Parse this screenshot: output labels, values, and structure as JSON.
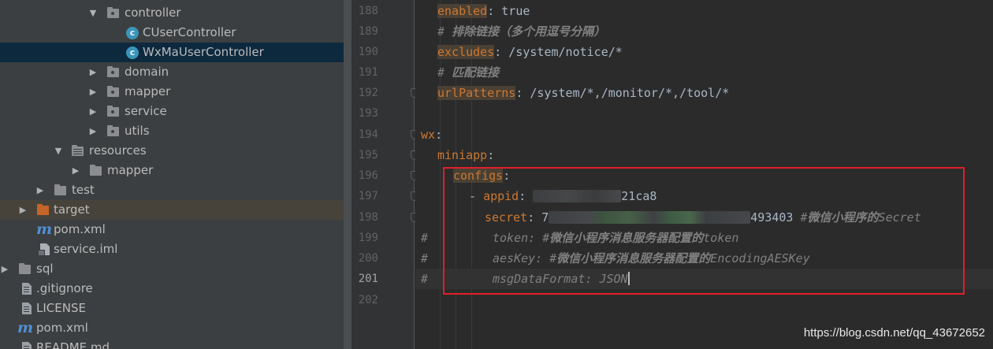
{
  "tree": {
    "items": [
      {
        "label": "controller",
        "arrow": "▼",
        "icon": "package-folder-icon",
        "level": "pkg"
      },
      {
        "label": "CUserController",
        "arrow": "",
        "icon": "java-class-icon"
      },
      {
        "label": "WxMaUserController",
        "arrow": "",
        "icon": "java-class-icon",
        "selected": true
      },
      {
        "label": "domain",
        "arrow": "▶",
        "icon": "package-folder-icon"
      },
      {
        "label": "mapper",
        "arrow": "▶",
        "icon": "package-folder-icon"
      },
      {
        "label": "service",
        "arrow": "▶",
        "icon": "package-folder-icon"
      },
      {
        "label": "utils",
        "arrow": "▶",
        "icon": "package-folder-icon"
      },
      {
        "label": "resources",
        "arrow": "▼",
        "icon": "resources-folder-icon"
      },
      {
        "label": "mapper",
        "arrow": "▶",
        "icon": "folder-icon"
      },
      {
        "label": "test",
        "arrow": "▶",
        "icon": "folder-icon"
      },
      {
        "label": "target",
        "arrow": "▶",
        "icon": "excluded-folder-icon"
      },
      {
        "label": "pom.xml",
        "arrow": "",
        "icon": "maven-icon"
      },
      {
        "label": "service.iml",
        "arrow": "",
        "icon": "iml-file-icon"
      },
      {
        "label": "sql",
        "arrow": "▶",
        "icon": "folder-icon"
      },
      {
        "label": ".gitignore",
        "arrow": "",
        "icon": "text-file-icon"
      },
      {
        "label": "LICENSE",
        "arrow": "",
        "icon": "text-file-icon"
      },
      {
        "label": "pom.xml",
        "arrow": "",
        "icon": "maven-icon"
      },
      {
        "label": "README.md",
        "arrow": "",
        "icon": "markdown-file-icon"
      }
    ]
  },
  "editor": {
    "line_numbers": [
      "188",
      "189",
      "190",
      "191",
      "192",
      "193",
      "194",
      "195",
      "196",
      "197",
      "198",
      "199",
      "200",
      "201",
      "202"
    ],
    "current_line": "201",
    "lines": {
      "l188_key": "enabled",
      "l188_rest": ": true",
      "l189_prefix": "# ",
      "l189_cn": "排除链接（多个用逗号分隔）",
      "l190_key": "excludes",
      "l190_rest": ": /system/notice/*",
      "l191_prefix": "# ",
      "l191_cn": "匹配链接",
      "l192_key": "urlPatterns",
      "l192_rest": ": /system/*,/monitor/*,/tool/*",
      "l194_key": "wx",
      "l194_rest": ":",
      "l195_key": "miniapp",
      "l195_rest": ":",
      "l196_key": "configs",
      "l196_rest": ":",
      "l197_dash": "- ",
      "l197_key": "appid",
      "l197_colon": ": ",
      "l197_tail": "21ca8",
      "l198_key": "secret",
      "l198_colon": ": ",
      "l198_head": "7",
      "l198_tail": "493403 ",
      "l198_hash": "#",
      "l198_cn": "微信小程序的",
      "l198_word": "Secret",
      "l199_hash": "#",
      "l199_key": "token: #",
      "l199_cn": "微信小程序消息服务器配置的",
      "l199_word": "token",
      "l200_hash": "#",
      "l200_key": "aesKey: #",
      "l200_cn": "微信小程序消息服务器配置的",
      "l200_word": "EncodingAESKey",
      "l201_hash": "#",
      "l201_key": "msgDataFormat: JSON"
    }
  },
  "watermark": "https://blog.csdn.net/qq_43672652",
  "colors": {
    "highlight_box": "#e0202a",
    "keyword": "#cc7832",
    "comment": "#808080"
  }
}
